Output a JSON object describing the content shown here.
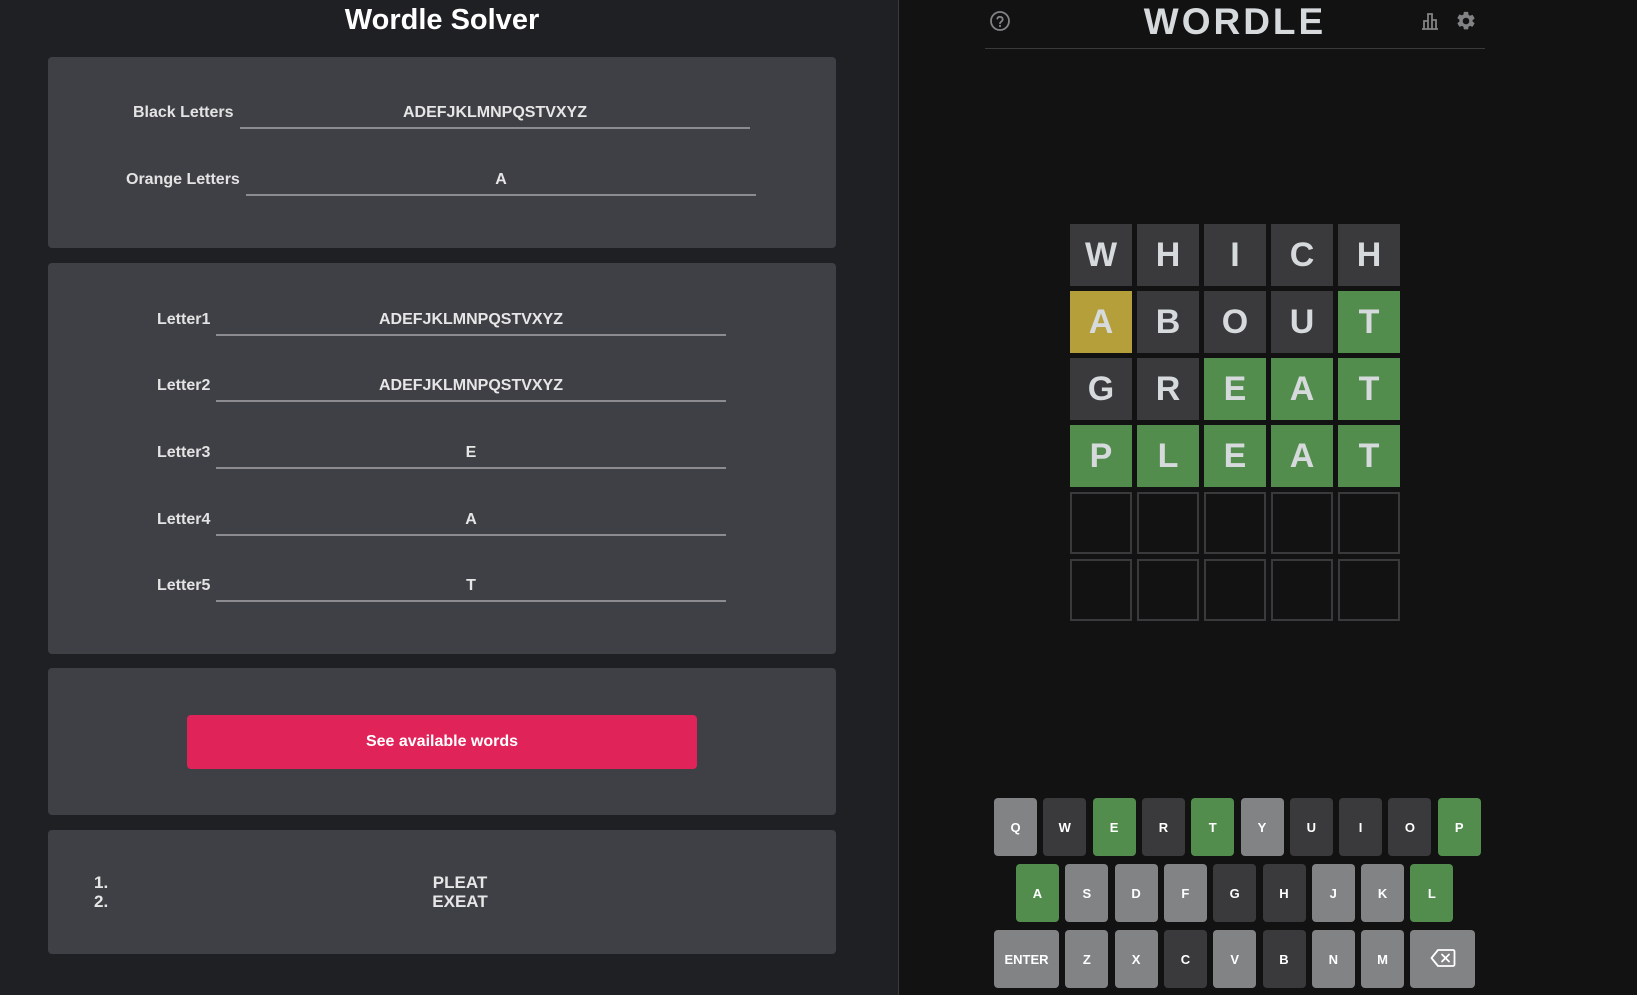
{
  "solver": {
    "title": "Wordle Solver",
    "black_letters": {
      "label": "Black Letters",
      "value": "ADEFJKLMNPQSTVXYZ"
    },
    "orange_letters": {
      "label": "Orange Letters",
      "value": "A"
    },
    "letters": [
      {
        "label": "Letter1",
        "value": "ADEFJKLMNPQSTVXYZ"
      },
      {
        "label": "Letter2",
        "value": "ADEFJKLMNPQSTVXYZ"
      },
      {
        "label": "Letter3",
        "value": "E"
      },
      {
        "label": "Letter4",
        "value": "A"
      },
      {
        "label": "Letter5",
        "value": "T"
      }
    ],
    "see_button_label": "See available words",
    "results": [
      {
        "num": "1.",
        "word": "PLEAT"
      },
      {
        "num": "2.",
        "word": "EXEAT"
      }
    ]
  },
  "wordle": {
    "title": "WORDLE",
    "icons": {
      "help": "help-circle-icon",
      "stats": "bar-chart-icon",
      "settings": "gear-icon"
    },
    "board": [
      [
        {
          "letter": "W",
          "state": "absent"
        },
        {
          "letter": "H",
          "state": "absent"
        },
        {
          "letter": "I",
          "state": "absent"
        },
        {
          "letter": "C",
          "state": "absent"
        },
        {
          "letter": "H",
          "state": "absent"
        }
      ],
      [
        {
          "letter": "A",
          "state": "present"
        },
        {
          "letter": "B",
          "state": "absent"
        },
        {
          "letter": "O",
          "state": "absent"
        },
        {
          "letter": "U",
          "state": "absent"
        },
        {
          "letter": "T",
          "state": "correct"
        }
      ],
      [
        {
          "letter": "G",
          "state": "absent"
        },
        {
          "letter": "R",
          "state": "absent"
        },
        {
          "letter": "E",
          "state": "correct"
        },
        {
          "letter": "A",
          "state": "correct"
        },
        {
          "letter": "T",
          "state": "correct"
        }
      ],
      [
        {
          "letter": "P",
          "state": "correct"
        },
        {
          "letter": "L",
          "state": "correct"
        },
        {
          "letter": "E",
          "state": "correct"
        },
        {
          "letter": "A",
          "state": "correct"
        },
        {
          "letter": "T",
          "state": "correct"
        }
      ],
      [
        {
          "letter": "",
          "state": "empty"
        },
        {
          "letter": "",
          "state": "empty"
        },
        {
          "letter": "",
          "state": "empty"
        },
        {
          "letter": "",
          "state": "empty"
        },
        {
          "letter": "",
          "state": "empty"
        }
      ],
      [
        {
          "letter": "",
          "state": "empty"
        },
        {
          "letter": "",
          "state": "empty"
        },
        {
          "letter": "",
          "state": "empty"
        },
        {
          "letter": "",
          "state": "empty"
        },
        {
          "letter": "",
          "state": "empty"
        }
      ]
    ],
    "keyboard": [
      [
        {
          "key": "Q",
          "state": "unused"
        },
        {
          "key": "W",
          "state": "absent"
        },
        {
          "key": "E",
          "state": "correct"
        },
        {
          "key": "R",
          "state": "absent"
        },
        {
          "key": "T",
          "state": "correct"
        },
        {
          "key": "Y",
          "state": "unused"
        },
        {
          "key": "U",
          "state": "absent"
        },
        {
          "key": "I",
          "state": "absent"
        },
        {
          "key": "O",
          "state": "absent"
        },
        {
          "key": "P",
          "state": "correct"
        }
      ],
      [
        {
          "key": "A",
          "state": "correct"
        },
        {
          "key": "S",
          "state": "unused"
        },
        {
          "key": "D",
          "state": "unused"
        },
        {
          "key": "F",
          "state": "unused"
        },
        {
          "key": "G",
          "state": "absent"
        },
        {
          "key": "H",
          "state": "absent"
        },
        {
          "key": "J",
          "state": "unused"
        },
        {
          "key": "K",
          "state": "unused"
        },
        {
          "key": "L",
          "state": "correct"
        }
      ],
      [
        {
          "key": "ENTER",
          "state": "unused"
        },
        {
          "key": "Z",
          "state": "unused"
        },
        {
          "key": "X",
          "state": "unused"
        },
        {
          "key": "C",
          "state": "absent"
        },
        {
          "key": "V",
          "state": "unused"
        },
        {
          "key": "B",
          "state": "absent"
        },
        {
          "key": "N",
          "state": "unused"
        },
        {
          "key": "M",
          "state": "unused"
        },
        {
          "key": "backspace-icon",
          "state": "unused",
          "icon": true
        }
      ]
    ]
  }
}
